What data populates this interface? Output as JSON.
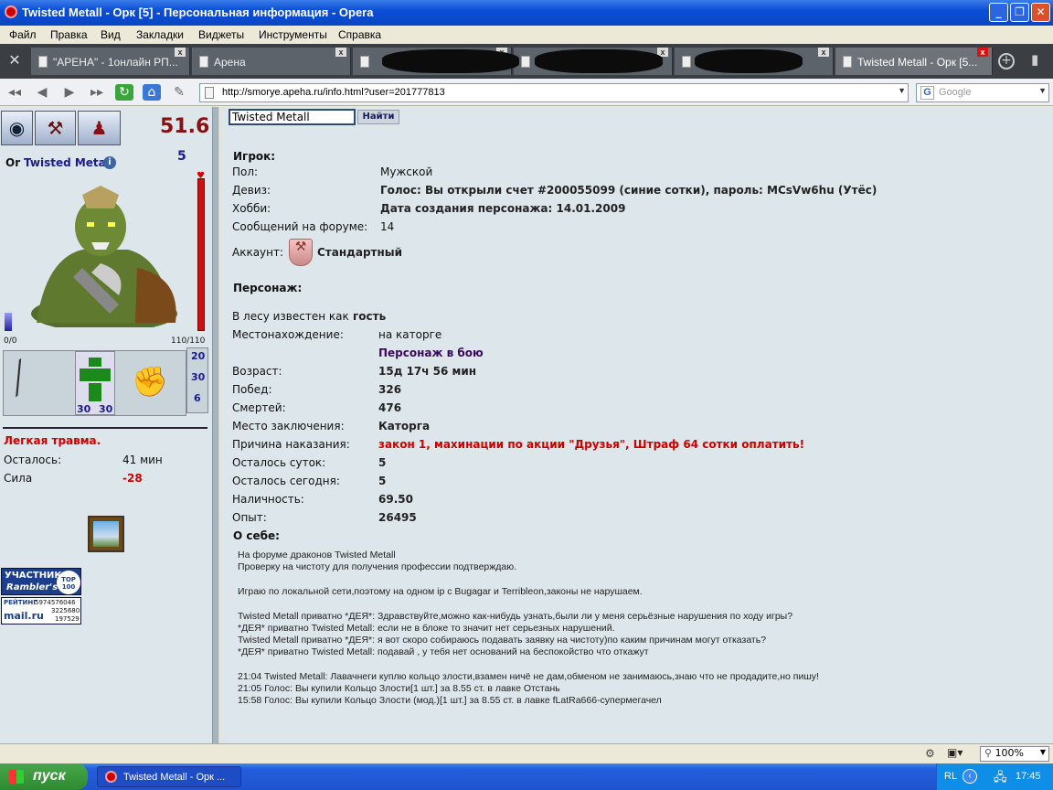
{
  "window": {
    "title": "Twisted Metall - Орк [5] - Персональная информация - Opera"
  },
  "menu": [
    "Файл",
    "Правка",
    "Вид",
    "Закладки",
    "Виджеты",
    "Инструменты",
    "Справка"
  ],
  "tabs": [
    {
      "label": "\"АРЕНА\" - 1онлайн РП..."
    },
    {
      "label": "Арена"
    },
    {
      "label": ""
    },
    {
      "label": ""
    },
    {
      "label": ""
    },
    {
      "label": "Twisted Metall - Орк [5..."
    }
  ],
  "address": {
    "url": "http://smorye.apeha.ru/info.html?user=201777813",
    "search_placeholder": "Google"
  },
  "colors": {
    "accent_red": "#cc0000",
    "name_blue": "#1a1a8c",
    "status_purple": "#3a0a5a",
    "hp_bar": "#cc1111"
  },
  "icons": [
    "eye-icon",
    "tools-icon",
    "character-icon",
    "info-icon",
    "spear-icon",
    "fist-icon",
    "portrait-icon"
  ],
  "char": {
    "rating": "51.6",
    "level": "5",
    "race_prefix": "Or",
    "name": "Twisted Metall",
    "mana": "0/0",
    "hp": "110/110",
    "armor_left": "30",
    "armor_right": "30",
    "stat1": "20",
    "stat2": "30",
    "stat3": "6",
    "injury": "Легкая травма.",
    "injury_left_label": "Осталось:",
    "injury_left_val": "41 мин",
    "strength_label": "Сила",
    "strength_val": "-28"
  },
  "banners": {
    "rambler_title": "УЧАСТНИК",
    "rambler_name": "Rambler's",
    "rambler_top": "TOP 100",
    "mail_rating": "РЕЙТИНГ",
    "mail_n1": "5974576046",
    "mail_n2": "3225680",
    "mail_n3": "197529",
    "mail_logo": "mail.ru"
  },
  "search": {
    "value": "Twisted Metall",
    "button": "Найти"
  },
  "player": {
    "heading": "Игрок:",
    "rows": [
      {
        "label": "Пол:",
        "value": "Мужской"
      },
      {
        "label": "Девиз:",
        "value": "Голос: Вы открыли счет #200055099 (синие сотки), пароль: MCsVw6hu (Утёс)"
      },
      {
        "label": "Хобби:",
        "value": "Дата создания персонажа: 14.01.2009"
      },
      {
        "label": "Сообщений на форуме:",
        "value": "14"
      }
    ],
    "account_label": "Аккаунт:",
    "account_value": "Стандартный"
  },
  "character": {
    "heading": "Персонаж:",
    "forest_text": "В лесу известен как",
    "forest_value": "гость",
    "location_label": "Местонахождение:",
    "location_value": "на каторге",
    "status": "Персонаж в бою",
    "rows": [
      {
        "label": "Возраст:",
        "value": "15д 17ч 56 мин"
      },
      {
        "label": "Побед:",
        "value": "326"
      },
      {
        "label": "Смертей:",
        "value": "476"
      },
      {
        "label": "Место заключения:",
        "value": "Каторга"
      },
      {
        "label": "Причина наказания:",
        "value": "закон 1, махинации по акции \"Друзья\", Штраф 64 сотки оплатить!"
      },
      {
        "label": "Осталось суток:",
        "value": "5"
      },
      {
        "label": "Осталось сегодня:",
        "value": "5"
      },
      {
        "label": "Наличность:",
        "value": "69.50"
      },
      {
        "label": "Опыт:",
        "value": "26495"
      }
    ],
    "about_heading": "О себе:"
  },
  "about": [
    "На форуме драконов Twisted Metall",
    "Проверку на чистоту для получения профессии подтверждаю.",
    "",
    "Играю по локальной сети,поэтому на одном ip с Bugagar и Terribleon,законы не нарушаем.",
    "",
    "Twisted Metall приватно *ДЕЯ*: Здравствуйте,можно как-нибудь узнать,были ли у меня серьёзные нарушения по ходу игры?",
    "*ДЕЯ* приватно Twisted Metall: если не в блоке то значит нет серьезных нарушений.",
    "Twisted Metall приватно *ДЕЯ*: я вот скоро собираюсь подавать заявку на чистоту)по каким причинам могут отказать?",
    "*ДЕЯ* приватно Twisted Metall: подавай , у тебя нет оснований на беспокойство что откажут",
    "",
    "21:04 Twisted Metall: Лавачнеги куплю кольцо злости,взамен ничё не дам,обменом не занимаюсь,знаю что не продадите,но пишу!",
    "21:05 Голос: Вы купили Кольцо Злости[1 шт.] за 8.55 ст. в лавке Отстань",
    "15:58 Голос: Вы купили Кольцо Злости (мод.)[1 шт.] за 8.55 ст. в лавке fLatRa666-супермегачел"
  ],
  "status": {
    "zoom": "100%"
  },
  "taskbar": {
    "start": "пуск",
    "item": "Twisted Metall - Орк ...",
    "lang": "RL",
    "time": "17:45"
  }
}
